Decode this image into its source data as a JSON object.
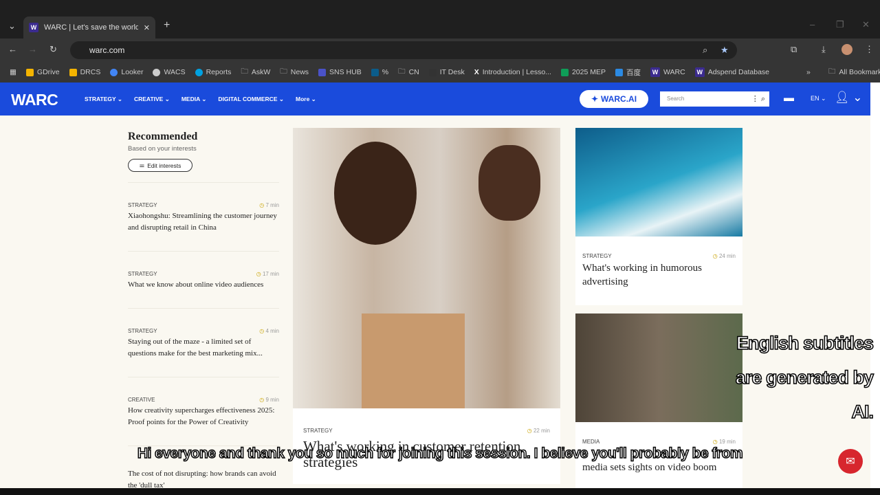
{
  "browser": {
    "tab_title": "WARC | Let's save the world fro",
    "url": "warc.com",
    "bookmarks": [
      {
        "label": "GDrive",
        "color": "#f4b400"
      },
      {
        "label": "DRCS",
        "color": "#f4b400"
      },
      {
        "label": "Looker",
        "color": "#4285f4"
      },
      {
        "label": "WACS",
        "color": "#cccccc"
      },
      {
        "label": "Reports",
        "color": "#00a1e0"
      },
      {
        "label": "AskW",
        "color": "#cccccc"
      },
      {
        "label": "News",
        "color": "#cccccc"
      },
      {
        "label": "SNS HUB",
        "color": "#4a52c8"
      },
      {
        "label": "%",
        "color": "#0b5c8a"
      },
      {
        "label": "CN",
        "color": "#cccccc"
      },
      {
        "label": "IT Desk",
        "color": "#333333"
      },
      {
        "label": "Introduction | Lesso...",
        "color": "#ffffff"
      },
      {
        "label": "2025 MEP",
        "color": "#0f9d58"
      },
      {
        "label": "百度",
        "color": "#2b8ae3"
      },
      {
        "label": "WARC",
        "color": "#3b2b8f"
      },
      {
        "label": "Adspend Database",
        "color": "#3b2b8f"
      }
    ],
    "all_bookmarks": "All Bookmarks"
  },
  "site": {
    "logo": "WARC",
    "nav": [
      "STRATEGY",
      "CREATIVE",
      "MEDIA",
      "DIGITAL COMMERCE",
      "More"
    ],
    "ai_button": "WARC.AI",
    "search_placeholder": "Search",
    "lang": "EN",
    "brand_color": "#1a4bdc"
  },
  "recommended": {
    "title": "Recommended",
    "subtitle": "Based on your interests",
    "edit": "Edit interests",
    "items": [
      {
        "cat": "STRATEGY",
        "time": "7 min",
        "title": "Xiaohongshu: Streamlining the customer journey and disrupting retail in China"
      },
      {
        "cat": "STRATEGY",
        "time": "17 min",
        "title": "What we know about online video audiences"
      },
      {
        "cat": "STRATEGY",
        "time": "4 min",
        "title": "Staying out of the maze - a limited set of questions make for the best marketing mix..."
      },
      {
        "cat": "CREATIVE",
        "time": "9 min",
        "title": "How creativity supercharges effectiveness 2025: Proof points for the Power of Creativity"
      },
      {
        "cat": "",
        "time": "",
        "title": "The cost of not disrupting: how brands can avoid the 'dull tax'"
      }
    ]
  },
  "hero": {
    "cat": "STRATEGY",
    "time": "22 min",
    "title": "What's working in customer retention strategies"
  },
  "cards": [
    {
      "cat": "STRATEGY",
      "time": "24 min",
      "title": "What's working in humorous advertising"
    },
    {
      "cat": "MEDIA",
      "time": "19 min",
      "title": "media sets sights on video boom"
    }
  ],
  "overlay": {
    "ai_note": "English subtitles are generated by AI.",
    "subtitle": "Hi everyone and thank you so much for joining this session. I believe you'll probably be from"
  }
}
